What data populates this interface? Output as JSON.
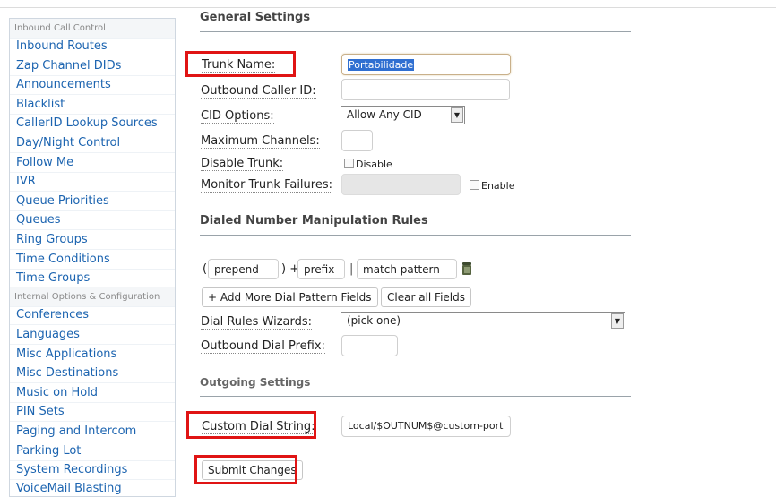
{
  "sidebar": {
    "items": [
      {
        "label": "Inbound Call Control",
        "header": true
      },
      {
        "label": "Inbound Routes"
      },
      {
        "label": "Zap Channel DIDs"
      },
      {
        "label": "Announcements"
      },
      {
        "label": "Blacklist"
      },
      {
        "label": "CallerID Lookup Sources"
      },
      {
        "label": "Day/Night Control"
      },
      {
        "label": "Follow Me"
      },
      {
        "label": "IVR"
      },
      {
        "label": "Queue Priorities"
      },
      {
        "label": "Queues"
      },
      {
        "label": "Ring Groups"
      },
      {
        "label": "Time Conditions"
      },
      {
        "label": "Time Groups"
      },
      {
        "label": "Internal Options & Configuration",
        "header": true
      },
      {
        "label": "Conferences"
      },
      {
        "label": "Languages"
      },
      {
        "label": "Misc Applications"
      },
      {
        "label": "Misc Destinations"
      },
      {
        "label": "Music on Hold"
      },
      {
        "label": "PIN Sets"
      },
      {
        "label": "Paging and Intercom"
      },
      {
        "label": "Parking Lot"
      },
      {
        "label": "System Recordings"
      },
      {
        "label": "VoiceMail Blasting"
      }
    ]
  },
  "general": {
    "title": "General Settings",
    "trunk_name": {
      "label": "Trunk Name:",
      "value": "Portabilidade"
    },
    "outbound_cid": {
      "label": "Outbound Caller ID:",
      "value": ""
    },
    "cid_options": {
      "label": "CID Options:",
      "value": "Allow Any CID"
    },
    "max_channels": {
      "label": "Maximum Channels:",
      "value": ""
    },
    "disable_trunk": {
      "label": "Disable Trunk:",
      "checkbox_label": "Disable",
      "checked": false
    },
    "monitor": {
      "label": "Monitor Trunk Failures:",
      "value": "",
      "checkbox_label": "Enable",
      "checked": false
    }
  },
  "dial_rules": {
    "title": "Dialed Number Manipulation Rules",
    "open_paren": "(",
    "prepend_placeholder": "prepend",
    "close_plus": ") +",
    "prefix_placeholder": "prefix",
    "pipe": "|",
    "match_placeholder": "match pattern",
    "add_button": "+ Add More Dial Pattern Fields",
    "clear_button": "Clear all Fields",
    "wizards": {
      "label": "Dial Rules Wizards:",
      "value": "(pick one)"
    },
    "outbound_prefix": {
      "label": "Outbound Dial Prefix:",
      "value": ""
    }
  },
  "outgoing": {
    "title": "Outgoing Settings",
    "custom_dial": {
      "label": "Custom Dial String:",
      "value": "Local/$OUTNUM$@custom-port"
    }
  },
  "submit": {
    "label": "Submit Changes"
  },
  "colors": {
    "highlight_box": "#e01414",
    "link": "#1c64b0",
    "selection": "#2f6fd1"
  }
}
